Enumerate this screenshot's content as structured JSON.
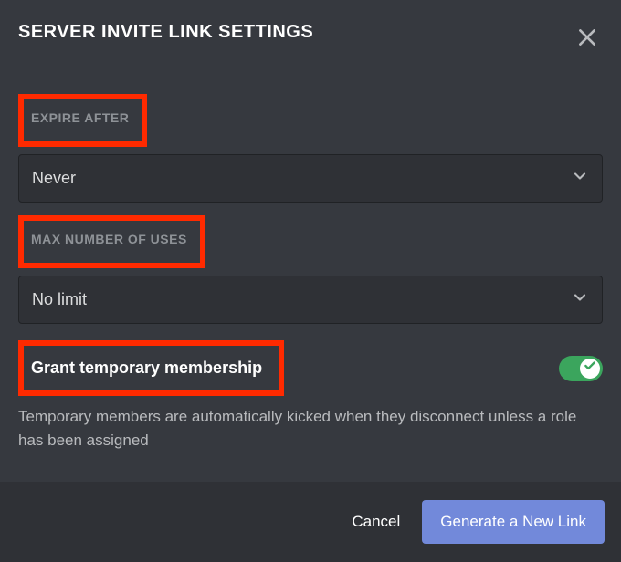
{
  "title": "SERVER INVITE LINK SETTINGS",
  "expire": {
    "label": "EXPIRE AFTER",
    "value": "Never"
  },
  "maxUses": {
    "label": "MAX NUMBER OF USES",
    "value": "No limit"
  },
  "tempMembership": {
    "label": "Grant temporary membership",
    "description": "Temporary members are automatically kicked when they disconnect unless a role has been assigned",
    "enabled": true
  },
  "footer": {
    "cancel": "Cancel",
    "generate": "Generate a New Link"
  }
}
